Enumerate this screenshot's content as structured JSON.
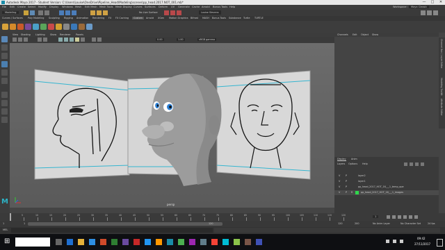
{
  "window": {
    "title": "Autodesk Maya 2017 - Student Version: C:\\Users\\Louise\\OneDrive\\Pipeline_Head\\Modeling\\scenes\\pp_head.2017.NOT_001.mb*",
    "minimize": "—",
    "maximize": "□",
    "close": "✕"
  },
  "menubar": {
    "items": [
      "File",
      "Edit",
      "Create",
      "Select",
      "Modify",
      "Display",
      "Windows",
      "Mesh",
      "Edit Mesh",
      "Mesh Tools",
      "Mesh Display",
      "Curves",
      "Surfaces",
      "Deform",
      "UV",
      "Generate",
      "Cache",
      "Arnold",
      "Bonus Tools",
      "Help"
    ],
    "workspace_label": "Workspace :",
    "workspace_value": "Maya Classic"
  },
  "statusline": {
    "mode": "Modeling",
    "live_surface": "No Live Surface",
    "login": "Louise Stevens"
  },
  "shelf_tabs": [
    "Curves / Surfaces",
    "Poly Modeling",
    "Sculpting",
    "Rigging",
    "Animation",
    "Rendering",
    "FX",
    "FX Caching",
    "Custom",
    "Arnold",
    "XGen",
    "Motion Graphics",
    "Bifrost",
    "MASH",
    "Bonus Tools",
    "Substance",
    "Turtle",
    "TURTLE"
  ],
  "panel": {
    "menus": [
      "View",
      "Shading",
      "Lighting",
      "Show",
      "Renderer",
      "Panels"
    ],
    "exposure": "0.00",
    "gamma": "1.00",
    "color_space": "sRGB gamma",
    "camera_label": "persp"
  },
  "right_panel": {
    "menus": [
      "Channels",
      "Edit",
      "Object",
      "Show"
    ],
    "side_tabs": [
      "Channel Box / Layer Editor",
      "Modeling Toolkit",
      "Attribute Editor"
    ]
  },
  "layer_editor": {
    "tabs": [
      "Display",
      "Anim"
    ],
    "menus": [
      "Layers",
      "Options",
      "Help"
    ],
    "layers": [
      {
        "v": "V",
        "p": "P",
        "r": "",
        "name": "layer2"
      },
      {
        "v": "V",
        "p": "P",
        "r": "",
        "name": "layer1"
      },
      {
        "v": "V",
        "p": "P",
        "r": "",
        "name": "pp_head_2017_HOT_16___1_temp_ope"
      },
      {
        "v": "V",
        "p": "P",
        "r": "R",
        "name": "pp_head_2017_HOT_16___1_images"
      }
    ]
  },
  "timeline": {
    "ticks": [
      "5",
      "10",
      "15",
      "20",
      "25",
      "30",
      "35",
      "40",
      "45",
      "50",
      "55",
      "60",
      "65",
      "70",
      "75",
      "80",
      "85",
      "90",
      "95",
      "100",
      "105",
      "110",
      "115",
      "120"
    ],
    "current_frame": "1",
    "range_start": "1",
    "range_inner_start": "1",
    "range_inner_end": "120",
    "range_end": "120",
    "anim_end": "200",
    "no_anim_layer": "No Anim Layer",
    "no_char_set": "No Character Set",
    "fps": "24 fps"
  },
  "mel": {
    "label": "MEL"
  },
  "taskbar": {
    "start": "⊞",
    "time": "09:42",
    "date": "27/11/2017"
  },
  "colors": {
    "accent_blue": "#3d6f8c",
    "maya_teal": "#2cb3c6",
    "grid_line": "#34b5d0",
    "layer_green": "#2fd84c"
  }
}
